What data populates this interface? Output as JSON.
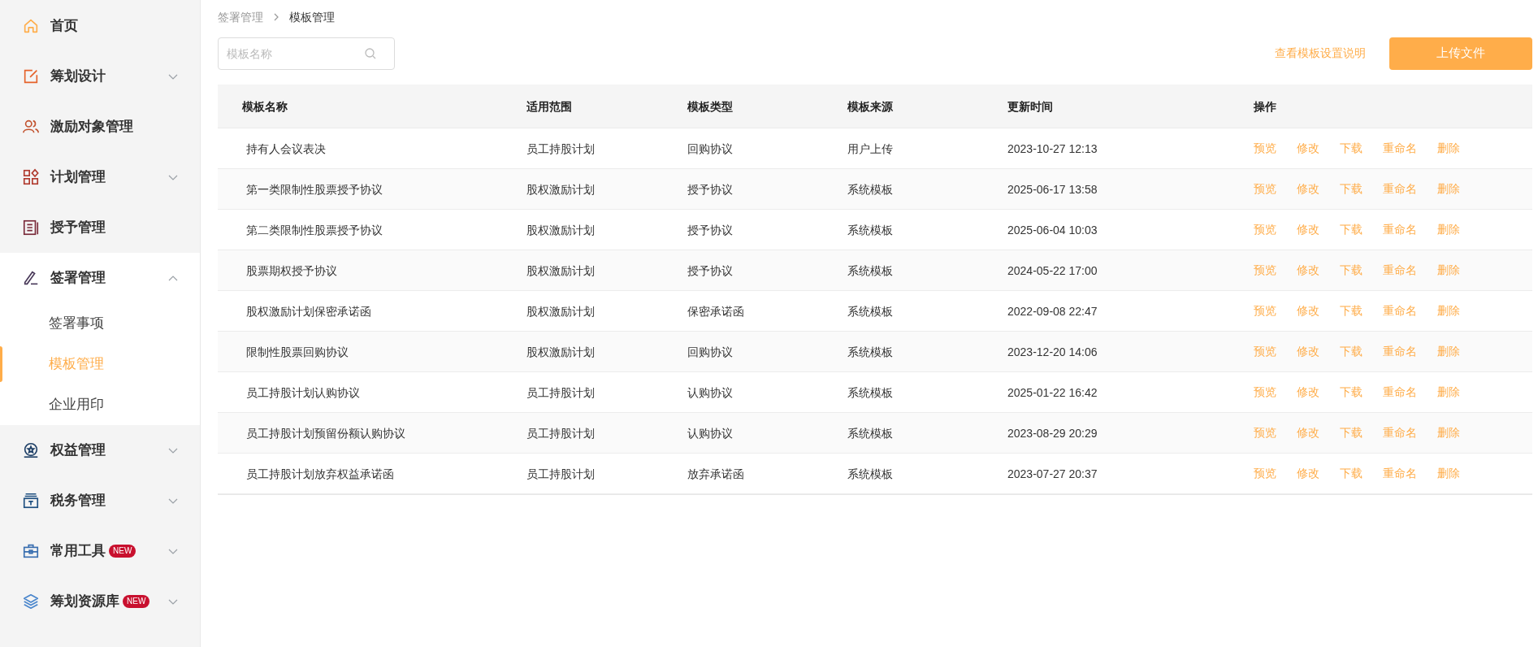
{
  "sidebar": {
    "items": [
      {
        "label": "首页"
      },
      {
        "label": "筹划设计",
        "expanded": false
      },
      {
        "label": "激励对象管理"
      },
      {
        "label": "计划管理",
        "expanded": false
      },
      {
        "label": "授予管理"
      },
      {
        "label": "签署管理",
        "expanded": true,
        "children": [
          {
            "label": "签署事项",
            "selected": false
          },
          {
            "label": "模板管理",
            "selected": true
          },
          {
            "label": "企业用印",
            "selected": false
          }
        ]
      },
      {
        "label": "权益管理",
        "expanded": false
      },
      {
        "label": "税务管理",
        "expanded": false
      },
      {
        "label": "常用工具",
        "badge": "NEW",
        "expanded": false
      },
      {
        "label": "筹划资源库",
        "badge": "NEW",
        "expanded": false
      }
    ]
  },
  "breadcrumb": [
    "签署管理",
    "模板管理"
  ],
  "search": {
    "placeholder": "模板名称"
  },
  "help_link": "查看模板设置说明",
  "upload_button": "上传文件",
  "table": {
    "columns": [
      "模板名称",
      "适用范围",
      "模板类型",
      "模板来源",
      "更新时间",
      "操作"
    ],
    "rows": [
      {
        "cells": [
          "持有人会议表决",
          "员工持股计划",
          "回购协议",
          "用户上传",
          "2023-10-27 12:13"
        ],
        "actions": [
          "预览",
          "修改",
          "下载",
          "重命名",
          "删除"
        ]
      },
      {
        "cells": [
          "第一类限制性股票授予协议",
          "股权激励计划",
          "授予协议",
          "系统模板",
          "2025-06-17 13:58"
        ],
        "actions": [
          "预览",
          "修改",
          "下载",
          "重命名",
          "删除"
        ]
      },
      {
        "cells": [
          "第二类限制性股票授予协议",
          "股权激励计划",
          "授予协议",
          "系统模板",
          "2025-06-04 10:03"
        ],
        "actions": [
          "预览",
          "修改",
          "下载",
          "重命名",
          "删除"
        ]
      },
      {
        "cells": [
          "股票期权授予协议",
          "股权激励计划",
          "授予协议",
          "系统模板",
          "2024-05-22 17:00"
        ],
        "actions": [
          "预览",
          "修改",
          "下载",
          "重命名",
          "删除"
        ]
      },
      {
        "cells": [
          "股权激励计划保密承诺函",
          "股权激励计划",
          "保密承诺函",
          "系统模板",
          "2022-09-08 22:47"
        ],
        "actions": [
          "预览",
          "修改",
          "下载",
          "重命名",
          "删除"
        ]
      },
      {
        "cells": [
          "限制性股票回购协议",
          "股权激励计划",
          "回购协议",
          "系统模板",
          "2023-12-20 14:06"
        ],
        "actions": [
          "预览",
          "修改",
          "下载",
          "重命名",
          "删除"
        ]
      },
      {
        "cells": [
          "员工持股计划认购协议",
          "员工持股计划",
          "认购协议",
          "系统模板",
          "2025-01-22 16:42"
        ],
        "actions": [
          "预览",
          "修改",
          "下载",
          "重命名",
          "删除"
        ]
      },
      {
        "cells": [
          "员工持股计划预留份额认购协议",
          "员工持股计划",
          "认购协议",
          "系统模板",
          "2023-08-29 20:29"
        ],
        "actions": [
          "预览",
          "修改",
          "下载",
          "重命名",
          "删除"
        ]
      },
      {
        "cells": [
          "员工持股计划放弃权益承诺函",
          "员工持股计划",
          "放弃承诺函",
          "系统模板",
          "2023-07-27 20:37"
        ],
        "actions": [
          "预览",
          "修改",
          "下载",
          "重命名",
          "删除"
        ]
      }
    ]
  }
}
